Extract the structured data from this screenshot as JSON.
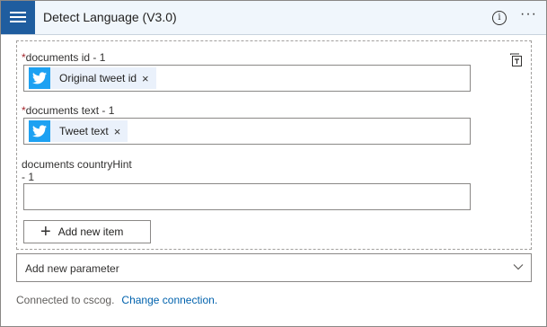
{
  "header": {
    "title": "Detect Language (V3.0)",
    "info_icon": "info-icon",
    "more_icon": "more-options-icon"
  },
  "fields": [
    {
      "required": true,
      "label": "documents id - 1",
      "token": "Original tweet id",
      "token_icon": "twitter-icon"
    },
    {
      "required": true,
      "label": "documents text - 1",
      "token": "Tweet text",
      "token_icon": "twitter-icon"
    },
    {
      "required": false,
      "label_line1": "documents countryHint",
      "label_line2": "- 1",
      "value": ""
    }
  ],
  "add_item_label": "Add new item",
  "add_param_placeholder": "Add new parameter",
  "footer": {
    "connected_text": "Connected to cscog.",
    "change_link": "Change connection."
  },
  "colors": {
    "header_bg": "#f0f6fc",
    "icon_bg": "#1f5d9f",
    "twitter_blue": "#1da1f2",
    "link": "#0062ad",
    "required": "#a4262c"
  }
}
